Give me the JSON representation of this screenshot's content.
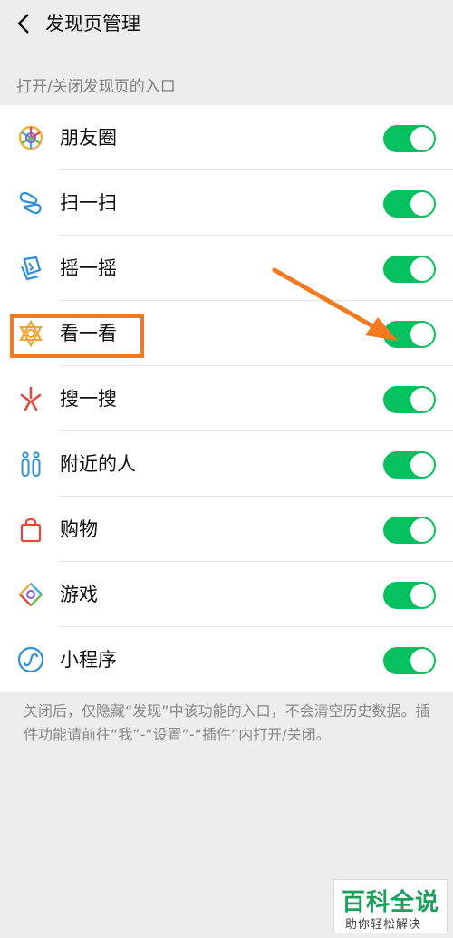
{
  "header": {
    "title": "发现页管理"
  },
  "section_label": "打开/关闭发现页的入口",
  "items": [
    {
      "label": "朋友圈",
      "enabled": true,
      "icon": "moments-icon"
    },
    {
      "label": "扫一扫",
      "enabled": true,
      "icon": "scan-icon"
    },
    {
      "label": "摇一摇",
      "enabled": true,
      "icon": "shake-icon"
    },
    {
      "label": "看一看",
      "enabled": true,
      "icon": "top-stories-icon"
    },
    {
      "label": "搜一搜",
      "enabled": true,
      "icon": "search-icon"
    },
    {
      "label": "附近的人",
      "enabled": true,
      "icon": "people-nearby-icon"
    },
    {
      "label": "购物",
      "enabled": true,
      "icon": "shopping-bag-icon"
    },
    {
      "label": "游戏",
      "enabled": true,
      "icon": "games-icon"
    },
    {
      "label": "小程序",
      "enabled": true,
      "icon": "mini-programs-icon"
    }
  ],
  "footnote": "关闭后，仅隐藏“发现”中该功能的入口，不会清空历史数据。插件功能请前往“我”-“设置”-“插件”内打开/关闭。",
  "watermark": {
    "title": "百科全说",
    "subtitle": "助你轻松解决"
  },
  "colors": {
    "toggle_on": "#07c160",
    "annotation": "#f47a20"
  }
}
